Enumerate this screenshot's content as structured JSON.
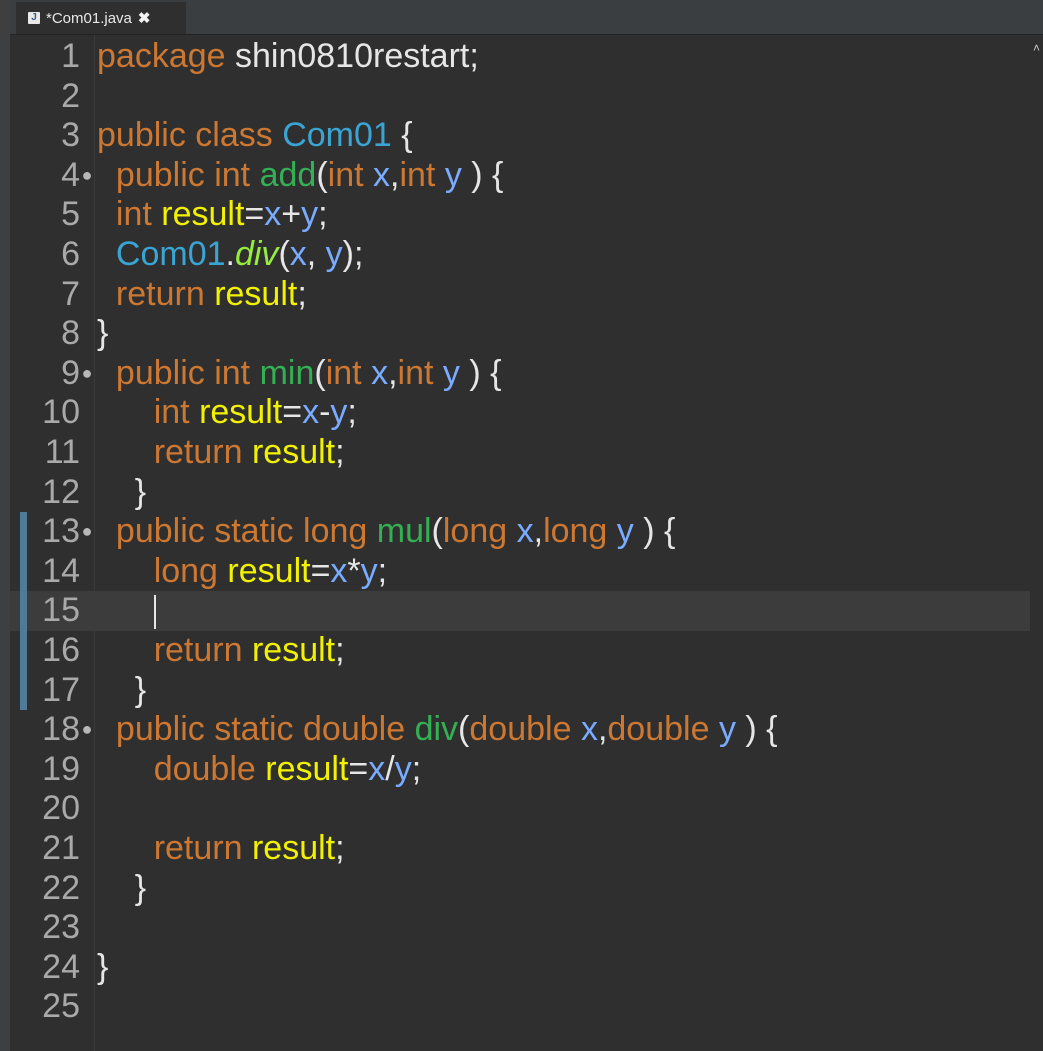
{
  "tab": {
    "label": "*Com01.java",
    "icon_glyph": "J",
    "close_glyph": "✖"
  },
  "editor": {
    "current_line": 15,
    "lines": [
      {
        "n": "1",
        "tokens": [
          [
            "kw",
            "package"
          ],
          [
            "pl",
            " shin0810restart;"
          ]
        ]
      },
      {
        "n": "2",
        "tokens": []
      },
      {
        "n": "3",
        "tokens": [
          [
            "kw",
            "public"
          ],
          [
            "pl",
            " "
          ],
          [
            "kw",
            "class"
          ],
          [
            "pl",
            " "
          ],
          [
            "ty",
            "Com01"
          ],
          [
            "pl",
            " {"
          ]
        ]
      },
      {
        "n": "4",
        "fold": "●",
        "tokens": [
          [
            "pl",
            "  "
          ],
          [
            "kw",
            "public"
          ],
          [
            "pl",
            " "
          ],
          [
            "kw",
            "int"
          ],
          [
            "pl",
            " "
          ],
          [
            "fn",
            "add"
          ],
          [
            "pl",
            "("
          ],
          [
            "kw",
            "int"
          ],
          [
            "pl",
            " "
          ],
          [
            "pm",
            "x"
          ],
          [
            "pl",
            ","
          ],
          [
            "kw",
            "int"
          ],
          [
            "pl",
            " "
          ],
          [
            "pm",
            "y"
          ],
          [
            "pl",
            " ) {"
          ]
        ]
      },
      {
        "n": "5",
        "tokens": [
          [
            "pl",
            "  "
          ],
          [
            "kw",
            "int"
          ],
          [
            "pl",
            " "
          ],
          [
            "lv",
            "result"
          ],
          [
            "pl",
            "="
          ],
          [
            "pm",
            "x"
          ],
          [
            "pl",
            "+"
          ],
          [
            "pm",
            "y"
          ],
          [
            "pl",
            ";"
          ]
        ]
      },
      {
        "n": "6",
        "tokens": [
          [
            "pl",
            "  "
          ],
          [
            "ty",
            "Com01"
          ],
          [
            "pl",
            "."
          ],
          [
            "it",
            "div"
          ],
          [
            "pl",
            "("
          ],
          [
            "pm",
            "x"
          ],
          [
            "pl",
            ", "
          ],
          [
            "pm",
            "y"
          ],
          [
            "pl",
            ");"
          ]
        ]
      },
      {
        "n": "7",
        "tokens": [
          [
            "pl",
            "  "
          ],
          [
            "kw",
            "return"
          ],
          [
            "pl",
            " "
          ],
          [
            "lv",
            "result"
          ],
          [
            "pl",
            ";"
          ]
        ]
      },
      {
        "n": "8",
        "tokens": [
          [
            "pl",
            "}"
          ]
        ]
      },
      {
        "n": "9",
        "fold": "●",
        "tokens": [
          [
            "pl",
            "  "
          ],
          [
            "kw",
            "public"
          ],
          [
            "pl",
            " "
          ],
          [
            "kw",
            "int"
          ],
          [
            "pl",
            " "
          ],
          [
            "fn",
            "min"
          ],
          [
            "pl",
            "("
          ],
          [
            "kw",
            "int"
          ],
          [
            "pl",
            " "
          ],
          [
            "pm",
            "x"
          ],
          [
            "pl",
            ","
          ],
          [
            "kw",
            "int"
          ],
          [
            "pl",
            " "
          ],
          [
            "pm",
            "y"
          ],
          [
            "pl",
            " ) {"
          ]
        ]
      },
      {
        "n": "10",
        "tokens": [
          [
            "pl",
            "      "
          ],
          [
            "kw",
            "int"
          ],
          [
            "pl",
            " "
          ],
          [
            "lv",
            "result"
          ],
          [
            "pl",
            "="
          ],
          [
            "pm",
            "x"
          ],
          [
            "pl",
            "-"
          ],
          [
            "pm",
            "y"
          ],
          [
            "pl",
            ";"
          ]
        ]
      },
      {
        "n": "11",
        "tokens": [
          [
            "pl",
            "      "
          ],
          [
            "kw",
            "return"
          ],
          [
            "pl",
            " "
          ],
          [
            "lv",
            "result"
          ],
          [
            "pl",
            ";"
          ]
        ]
      },
      {
        "n": "12",
        "tokens": [
          [
            "pl",
            "    }"
          ]
        ]
      },
      {
        "n": "13",
        "fold": "●",
        "changed": true,
        "tokens": [
          [
            "pl",
            "  "
          ],
          [
            "kw",
            "public"
          ],
          [
            "pl",
            " "
          ],
          [
            "kw",
            "static"
          ],
          [
            "pl",
            " "
          ],
          [
            "kw",
            "long"
          ],
          [
            "pl",
            " "
          ],
          [
            "fn",
            "mul"
          ],
          [
            "pl",
            "("
          ],
          [
            "kw",
            "long"
          ],
          [
            "pl",
            " "
          ],
          [
            "pm",
            "x"
          ],
          [
            "pl",
            ","
          ],
          [
            "kw",
            "long"
          ],
          [
            "pl",
            " "
          ],
          [
            "pm",
            "y"
          ],
          [
            "pl",
            " ) {"
          ]
        ]
      },
      {
        "n": "14",
        "changed": true,
        "tokens": [
          [
            "pl",
            "      "
          ],
          [
            "kw",
            "long"
          ],
          [
            "pl",
            " "
          ],
          [
            "lv",
            "result"
          ],
          [
            "pl",
            "="
          ],
          [
            "pm",
            "x"
          ],
          [
            "pl",
            "*"
          ],
          [
            "pm",
            "y"
          ],
          [
            "pl",
            ";"
          ]
        ]
      },
      {
        "n": "15",
        "changed": true,
        "caret": true,
        "tokens": [
          [
            "pl",
            "      "
          ]
        ]
      },
      {
        "n": "16",
        "changed": true,
        "tokens": [
          [
            "pl",
            "      "
          ],
          [
            "kw",
            "return"
          ],
          [
            "pl",
            " "
          ],
          [
            "lv",
            "result"
          ],
          [
            "pl",
            ";"
          ]
        ]
      },
      {
        "n": "17",
        "changed": true,
        "tokens": [
          [
            "pl",
            "    }"
          ]
        ]
      },
      {
        "n": "18",
        "fold": "●",
        "tokens": [
          [
            "pl",
            "  "
          ],
          [
            "kw",
            "public"
          ],
          [
            "pl",
            " "
          ],
          [
            "kw",
            "static"
          ],
          [
            "pl",
            " "
          ],
          [
            "kw",
            "double"
          ],
          [
            "pl",
            " "
          ],
          [
            "fn",
            "div"
          ],
          [
            "pl",
            "("
          ],
          [
            "kw",
            "double"
          ],
          [
            "pl",
            " "
          ],
          [
            "pm",
            "x"
          ],
          [
            "pl",
            ","
          ],
          [
            "kw",
            "double"
          ],
          [
            "pl",
            " "
          ],
          [
            "pm",
            "y"
          ],
          [
            "pl",
            " ) {"
          ]
        ]
      },
      {
        "n": "19",
        "tokens": [
          [
            "pl",
            "      "
          ],
          [
            "kw",
            "double"
          ],
          [
            "pl",
            " "
          ],
          [
            "lv",
            "result"
          ],
          [
            "pl",
            "="
          ],
          [
            "pm",
            "x"
          ],
          [
            "pl",
            "/"
          ],
          [
            "pm",
            "y"
          ],
          [
            "pl",
            ";"
          ]
        ]
      },
      {
        "n": "20",
        "tokens": []
      },
      {
        "n": "21",
        "tokens": [
          [
            "pl",
            "      "
          ],
          [
            "kw",
            "return"
          ],
          [
            "pl",
            " "
          ],
          [
            "lv",
            "result"
          ],
          [
            "pl",
            ";"
          ]
        ]
      },
      {
        "n": "22",
        "tokens": [
          [
            "pl",
            "    }"
          ]
        ]
      },
      {
        "n": "23",
        "tokens": []
      },
      {
        "n": "24",
        "tokens": [
          [
            "pl",
            "}"
          ]
        ]
      },
      {
        "n": "25",
        "tokens": []
      }
    ]
  },
  "scrollbar": {
    "up_glyph": "˄"
  }
}
